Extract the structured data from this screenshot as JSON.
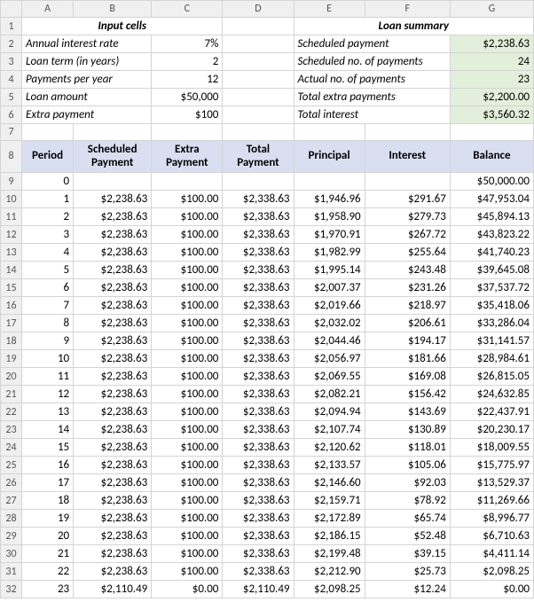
{
  "cols": [
    "A",
    "B",
    "C",
    "D",
    "E",
    "F",
    "G"
  ],
  "sections": {
    "input_title": "Input cells",
    "summary_title": "Loan summary"
  },
  "inputs": {
    "annual_rate_label": "Annual interest rate",
    "annual_rate_value": "7%",
    "loan_term_label": "Loan term (in years)",
    "loan_term_value": "2",
    "ppy_label": "Payments per year",
    "ppy_value": "12",
    "loan_amount_label": "Loan amount",
    "loan_amount_value": "$50,000",
    "extra_label": "Extra payment",
    "extra_value": "$100"
  },
  "summary": {
    "sched_pay_label": "Scheduled payment",
    "sched_pay_value": "$2,238.63",
    "sched_n_label": "Scheduled no. of payments",
    "sched_n_value": "24",
    "actual_n_label": "Actual no. of payments",
    "actual_n_value": "23",
    "total_extra_label": "Total extra payments",
    "total_extra_value": "$2,200.00",
    "total_interest_label": "Total interest",
    "total_interest_value": "$3,560.32"
  },
  "headers": {
    "period": "Period",
    "sched": "Scheduled Payment",
    "extra": "Extra Payment",
    "total": "Total Payment",
    "principal": "Principal",
    "interest": "Interest",
    "balance": "Balance"
  },
  "rows": [
    {
      "r": 9,
      "period": "0",
      "sched": "",
      "extra": "",
      "total": "",
      "principal": "",
      "interest": "",
      "balance": "$50,000.00"
    },
    {
      "r": 10,
      "period": "1",
      "sched": "$2,238.63",
      "extra": "$100.00",
      "total": "$2,338.63",
      "principal": "$1,946.96",
      "interest": "$291.67",
      "balance": "$47,953.04"
    },
    {
      "r": 11,
      "period": "2",
      "sched": "$2,238.63",
      "extra": "$100.00",
      "total": "$2,338.63",
      "principal": "$1,958.90",
      "interest": "$279.73",
      "balance": "$45,894.13"
    },
    {
      "r": 12,
      "period": "3",
      "sched": "$2,238.63",
      "extra": "$100.00",
      "total": "$2,338.63",
      "principal": "$1,970.91",
      "interest": "$267.72",
      "balance": "$43,823.22"
    },
    {
      "r": 13,
      "period": "4",
      "sched": "$2,238.63",
      "extra": "$100.00",
      "total": "$2,338.63",
      "principal": "$1,982.99",
      "interest": "$255.64",
      "balance": "$41,740.23"
    },
    {
      "r": 14,
      "period": "5",
      "sched": "$2,238.63",
      "extra": "$100.00",
      "total": "$2,338.63",
      "principal": "$1,995.14",
      "interest": "$243.48",
      "balance": "$39,645.08"
    },
    {
      "r": 15,
      "period": "6",
      "sched": "$2,238.63",
      "extra": "$100.00",
      "total": "$2,338.63",
      "principal": "$2,007.37",
      "interest": "$231.26",
      "balance": "$37,537.72"
    },
    {
      "r": 16,
      "period": "7",
      "sched": "$2,238.63",
      "extra": "$100.00",
      "total": "$2,338.63",
      "principal": "$2,019.66",
      "interest": "$218.97",
      "balance": "$35,418.06"
    },
    {
      "r": 17,
      "period": "8",
      "sched": "$2,238.63",
      "extra": "$100.00",
      "total": "$2,338.63",
      "principal": "$2,032.02",
      "interest": "$206.61",
      "balance": "$33,286.04"
    },
    {
      "r": 18,
      "period": "9",
      "sched": "$2,238.63",
      "extra": "$100.00",
      "total": "$2,338.63",
      "principal": "$2,044.46",
      "interest": "$194.17",
      "balance": "$31,141.57"
    },
    {
      "r": 19,
      "period": "10",
      "sched": "$2,238.63",
      "extra": "$100.00",
      "total": "$2,338.63",
      "principal": "$2,056.97",
      "interest": "$181.66",
      "balance": "$28,984.61"
    },
    {
      "r": 20,
      "period": "11",
      "sched": "$2,238.63",
      "extra": "$100.00",
      "total": "$2,338.63",
      "principal": "$2,069.55",
      "interest": "$169.08",
      "balance": "$26,815.05"
    },
    {
      "r": 21,
      "period": "12",
      "sched": "$2,238.63",
      "extra": "$100.00",
      "total": "$2,338.63",
      "principal": "$2,082.21",
      "interest": "$156.42",
      "balance": "$24,632.85"
    },
    {
      "r": 22,
      "period": "13",
      "sched": "$2,238.63",
      "extra": "$100.00",
      "total": "$2,338.63",
      "principal": "$2,094.94",
      "interest": "$143.69",
      "balance": "$22,437.91"
    },
    {
      "r": 23,
      "period": "14",
      "sched": "$2,238.63",
      "extra": "$100.00",
      "total": "$2,338.63",
      "principal": "$2,107.74",
      "interest": "$130.89",
      "balance": "$20,230.17"
    },
    {
      "r": 24,
      "period": "15",
      "sched": "$2,238.63",
      "extra": "$100.00",
      "total": "$2,338.63",
      "principal": "$2,120.62",
      "interest": "$118.01",
      "balance": "$18,009.55"
    },
    {
      "r": 25,
      "period": "16",
      "sched": "$2,238.63",
      "extra": "$100.00",
      "total": "$2,338.63",
      "principal": "$2,133.57",
      "interest": "$105.06",
      "balance": "$15,775.97"
    },
    {
      "r": 26,
      "period": "17",
      "sched": "$2,238.63",
      "extra": "$100.00",
      "total": "$2,338.63",
      "principal": "$2,146.60",
      "interest": "$92.03",
      "balance": "$13,529.37"
    },
    {
      "r": 27,
      "period": "18",
      "sched": "$2,238.63",
      "extra": "$100.00",
      "total": "$2,338.63",
      "principal": "$2,159.71",
      "interest": "$78.92",
      "balance": "$11,269.66"
    },
    {
      "r": 28,
      "period": "19",
      "sched": "$2,238.63",
      "extra": "$100.00",
      "total": "$2,338.63",
      "principal": "$2,172.89",
      "interest": "$65.74",
      "balance": "$8,996.77"
    },
    {
      "r": 29,
      "period": "20",
      "sched": "$2,238.63",
      "extra": "$100.00",
      "total": "$2,338.63",
      "principal": "$2,186.15",
      "interest": "$52.48",
      "balance": "$6,710.63"
    },
    {
      "r": 30,
      "period": "21",
      "sched": "$2,238.63",
      "extra": "$100.00",
      "total": "$2,338.63",
      "principal": "$2,199.48",
      "interest": "$39.15",
      "balance": "$4,411.14"
    },
    {
      "r": 31,
      "period": "22",
      "sched": "$2,238.63",
      "extra": "$100.00",
      "total": "$2,338.63",
      "principal": "$2,212.90",
      "interest": "$25.73",
      "balance": "$2,098.25"
    },
    {
      "r": 32,
      "period": "23",
      "sched": "$2,110.49",
      "extra": "$0.00",
      "total": "$2,110.49",
      "principal": "$2,098.25",
      "interest": "$12.24",
      "balance": "$0.00"
    }
  ],
  "chart_data": {
    "type": "table",
    "title": "Loan amortization schedule",
    "columns": [
      "Period",
      "Scheduled Payment",
      "Extra Payment",
      "Total Payment",
      "Principal",
      "Interest",
      "Balance"
    ],
    "data": [
      [
        0,
        null,
        null,
        null,
        null,
        null,
        50000.0
      ],
      [
        1,
        2238.63,
        100.0,
        2338.63,
        1946.96,
        291.67,
        47953.04
      ],
      [
        2,
        2238.63,
        100.0,
        2338.63,
        1958.9,
        279.73,
        45894.13
      ],
      [
        3,
        2238.63,
        100.0,
        2338.63,
        1970.91,
        267.72,
        43823.22
      ],
      [
        4,
        2238.63,
        100.0,
        2338.63,
        1982.99,
        255.64,
        41740.23
      ],
      [
        5,
        2238.63,
        100.0,
        2338.63,
        1995.14,
        243.48,
        39645.08
      ],
      [
        6,
        2238.63,
        100.0,
        2338.63,
        2007.37,
        231.26,
        37537.72
      ],
      [
        7,
        2238.63,
        100.0,
        2338.63,
        2019.66,
        218.97,
        35418.06
      ],
      [
        8,
        2238.63,
        100.0,
        2338.63,
        2032.02,
        206.61,
        33286.04
      ],
      [
        9,
        2238.63,
        100.0,
        2338.63,
        2044.46,
        194.17,
        31141.57
      ],
      [
        10,
        2238.63,
        100.0,
        2338.63,
        2056.97,
        181.66,
        28984.61
      ],
      [
        11,
        2238.63,
        100.0,
        2338.63,
        2069.55,
        169.08,
        26815.05
      ],
      [
        12,
        2238.63,
        100.0,
        2338.63,
        2082.21,
        156.42,
        24632.85
      ],
      [
        13,
        2238.63,
        100.0,
        2338.63,
        2094.94,
        143.69,
        22437.91
      ],
      [
        14,
        2238.63,
        100.0,
        2338.63,
        2107.74,
        130.89,
        20230.17
      ],
      [
        15,
        2238.63,
        100.0,
        2338.63,
        2120.62,
        118.01,
        18009.55
      ],
      [
        16,
        2238.63,
        100.0,
        2338.63,
        2133.57,
        105.06,
        15775.97
      ],
      [
        17,
        2238.63,
        100.0,
        2338.63,
        2146.6,
        92.03,
        13529.37
      ],
      [
        18,
        2238.63,
        100.0,
        2338.63,
        2159.71,
        78.92,
        11269.66
      ],
      [
        19,
        2238.63,
        100.0,
        2338.63,
        2172.89,
        65.74,
        8996.77
      ],
      [
        20,
        2238.63,
        100.0,
        2338.63,
        2186.15,
        52.48,
        6710.63
      ],
      [
        21,
        2238.63,
        100.0,
        2338.63,
        2199.48,
        39.15,
        4411.14
      ],
      [
        22,
        2238.63,
        100.0,
        2338.63,
        2212.9,
        25.73,
        2098.25
      ],
      [
        23,
        2110.49,
        0.0,
        2110.49,
        2098.25,
        12.24,
        0.0
      ]
    ]
  }
}
